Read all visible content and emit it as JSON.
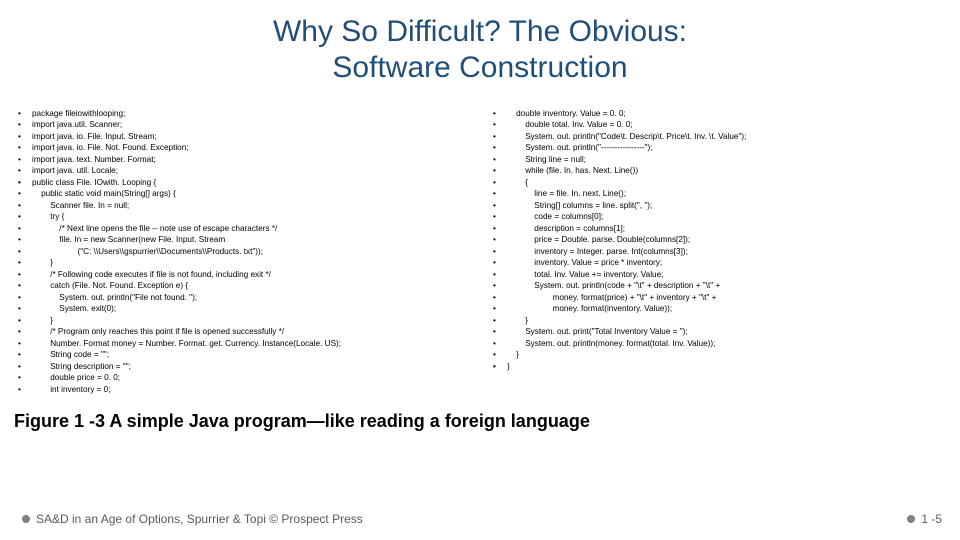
{
  "title_line1": "Why So Difficult? The Obvious:",
  "title_line2": "Software Construction",
  "code_left": [
    "package fileiowithlooping;",
    "import java.util. Scanner;",
    "import java. io. File. Input. Stream;",
    "import java. io. File. Not. Found. Exception;",
    "import java. text. Number. Format;",
    "import java. util. Locale;",
    "",
    "public class File. IOwith. Looping {",
    "    public static void main(String[] args) {",
    "        Scanner file. In = null;",
    "        try {",
    "            /* Next line opens the file -- note use of escape characters */",
    "            file. In = new Scanner(new File. Input. Stream",
    "                    (\"C: \\\\Users\\\\gspurrier\\\\Documents\\\\Products. txt\"));",
    "        }",
    "        /* Following code executes if file is not found, including exit */",
    "        catch (File. Not. Found. Exception e) {",
    "            System. out. println(\"File not found. \");",
    "            System. exit(0);",
    "        }",
    "        /* Program only reaches this point if file is opened successfully */",
    "        Number. Format money = Number. Format. get. Currency. Instance(Locale. US);",
    "        String code = \"\";",
    "        String description = \"\";",
    "        double price = 0. 0;",
    "        int inventory = 0;"
  ],
  "code_right": [
    "    double inventory. Value = 0. 0;",
    "        double total. Inv. Value = 0. 0;",
    "        System. out. println(\"Code\\t. Descrip\\t. Price\\t. Inv. \\t. Value\");",
    "        System. out. println(\"----------------\");",
    "        String line = null;",
    "        while (file. In. has. Next. Line())",
    "        {",
    "            line = file. In. next. Line();",
    "            String[] columns = line. split(\", \");",
    "            code = columns[0];",
    "            description = columns[1];",
    "            price = Double. parse. Double(columns[2]);",
    "            inventory = Integer. parse. Int(columns[3]);",
    "            inventory. Value = price * inventory;",
    "            total. Inv. Value += inventory. Value;",
    "            System. out. println(code + \"\\t\" + description + \"\\t\" +",
    "                    money. format(price) + \"\\t\" + inventory + \"\\t\" +",
    "                    money. format(inventory. Value));",
    "        }",
    "        System. out. print(\"Total Inventory Value = \");",
    "        System. out. println(money. format(total. Inv. Value));",
    "    }",
    "",
    "}"
  ],
  "caption": "Figure 1 -3 A simple Java program—like reading a foreign language",
  "footer_left": "SA&D in an Age of Options, Spurrier & Topi © Prospect Press",
  "footer_right": "1 -5"
}
